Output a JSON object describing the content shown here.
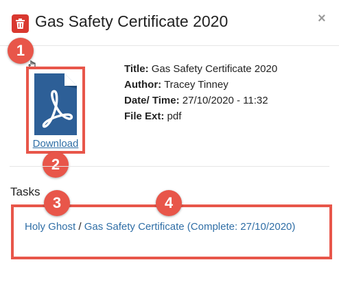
{
  "modal": {
    "title": "Gas Safety Certificate 2020",
    "close_glyph": "×",
    "trash_icon": "trash-icon"
  },
  "document": {
    "icon": "pdf-file-icon",
    "download_label": "Download",
    "fields": [
      {
        "label": "Title:",
        "value": "Gas Safety Certificate 2020"
      },
      {
        "label": "Author:",
        "value": "Tracey Tinney"
      },
      {
        "label": "Date/ Time:",
        "value": "27/10/2020 - 11:32"
      },
      {
        "label": "File Ext:",
        "value": "pdf"
      }
    ]
  },
  "tasks": {
    "heading": "Tasks",
    "property_link": "Holy Ghost",
    "separator": " / ",
    "task_link": "Gas Safety Certificate (Complete: 27/10/2020)"
  },
  "annotations": {
    "badges": [
      "1",
      "2",
      "3",
      "4"
    ],
    "color": "#e8564a"
  },
  "colors": {
    "trash_button": "#d9382f",
    "pdf_icon": "#2d5f97",
    "link": "#2f6ea6"
  }
}
